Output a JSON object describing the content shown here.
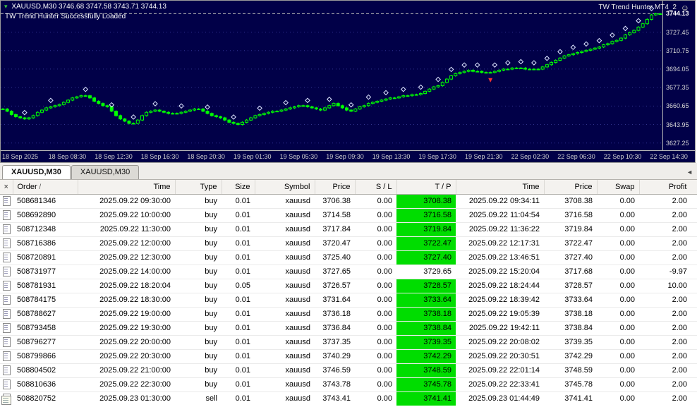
{
  "chart": {
    "symbol": "XAUUSD,M30",
    "ohlc": "3746.68 3747.58 3743.71 3744.13",
    "status_line": "TW Trend Hunter Successfully Loaded",
    "ea_label": "TW Trend Hunter MT4_2",
    "current_price": "3744.13",
    "price_labels": [
      "3727.45",
      "3710.75",
      "3694.05",
      "3677.35",
      "3660.65",
      "3643.95",
      "3627.25"
    ],
    "time_labels": [
      "18 Sep 2025",
      "18 Sep 08:30",
      "18 Sep 12:30",
      "18 Sep 16:30",
      "18 Sep 20:30",
      "19 Sep 01:30",
      "19 Sep 05:30",
      "19 Sep 09:30",
      "19 Sep 13:30",
      "19 Sep 17:30",
      "19 Sep 21:30",
      "22 Sep 02:30",
      "22 Sep 06:30",
      "22 Sep 10:30",
      "22 Sep 14:30"
    ]
  },
  "chart_data": {
    "type": "candlestick",
    "symbol": "XAUUSD",
    "timeframe": "M30",
    "ylim": [
      3622,
      3752
    ],
    "closes": [
      3658,
      3656,
      3653,
      3651,
      3650,
      3649,
      3650,
      3652,
      3655,
      3657,
      3659,
      3660,
      3661,
      3662,
      3664,
      3666,
      3668,
      3669,
      3670,
      3670,
      3668,
      3665,
      3663,
      3661,
      3660,
      3656,
      3652,
      3649,
      3647,
      3645,
      3645,
      3648,
      3652,
      3655,
      3656,
      3657,
      3656,
      3655,
      3654,
      3654,
      3654,
      3655,
      3656,
      3657,
      3658,
      3658,
      3656,
      3654,
      3652,
      3651,
      3650,
      3648,
      3646,
      3645,
      3644,
      3646,
      3648,
      3650,
      3652,
      3653,
      3654,
      3655,
      3656,
      3656,
      3657,
      3658,
      3659,
      3660,
      3661,
      3661,
      3660,
      3659,
      3658,
      3657,
      3659,
      3661,
      3663,
      3661,
      3659,
      3657,
      3656,
      3658,
      3660,
      3661,
      3663,
      3664,
      3665,
      3666,
      3667,
      3668,
      3668,
      3669,
      3670,
      3670,
      3671,
      3671,
      3672,
      3674,
      3676,
      3678,
      3679,
      3682,
      3685,
      3688,
      3690,
      3691,
      3692,
      3693,
      3692,
      3692,
      3691,
      3691,
      3691,
      3692,
      3693,
      3694,
      3694,
      3695,
      3695,
      3695,
      3694,
      3694,
      3694,
      3694,
      3696,
      3698,
      3700,
      3702,
      3704,
      3706,
      3707,
      3708,
      3709,
      3710,
      3711,
      3712,
      3713,
      3714,
      3716,
      3717,
      3719,
      3720,
      3722,
      3725,
      3727,
      3729,
      3732,
      3735,
      3739,
      3743,
      3744,
      3744
    ],
    "marker_indices": [
      5,
      11,
      19,
      25,
      30,
      35,
      41,
      47,
      53,
      59,
      65,
      70,
      75,
      80,
      84,
      88,
      92,
      96,
      100,
      103,
      106,
      109,
      113,
      116,
      119,
      122,
      125,
      128,
      131,
      134,
      137,
      140,
      143,
      146,
      149
    ],
    "sell_marker_index": 112
  },
  "colors": {
    "chart_background": "#010048",
    "bull_candle": "#00ff00",
    "grid": "#31318f",
    "tp_highlight": "#00dd00",
    "marker": "#dde4ff",
    "sell_marker": "#ff3030"
  },
  "tabs": {
    "items": [
      {
        "label": "XAUUSD,M30"
      },
      {
        "label": "XAUUSD,M30"
      }
    ],
    "active": 0,
    "scroll_left": "◄"
  },
  "history": {
    "sort_indicator": "/",
    "columns": [
      "Order",
      "Time",
      "Type",
      "Size",
      "Symbol",
      "Price",
      "S / L",
      "T / P",
      "Time",
      "Price",
      "Swap",
      "Profit"
    ],
    "rows": [
      {
        "order": "508681346",
        "open_time": "2025.09.22 09:30:00",
        "type": "buy",
        "size": "0.01",
        "symbol": "xauusd",
        "price": "3706.38",
        "sl": "0.00",
        "tp": "3708.38",
        "tp_hit": true,
        "close_time": "2025.09.22 09:34:11",
        "close_price": "3708.38",
        "swap": "0.00",
        "profit": "2.00"
      },
      {
        "order": "508692890",
        "open_time": "2025.09.22 10:00:00",
        "type": "buy",
        "size": "0.01",
        "symbol": "xauusd",
        "price": "3714.58",
        "sl": "0.00",
        "tp": "3716.58",
        "tp_hit": true,
        "close_time": "2025.09.22 11:04:54",
        "close_price": "3716.58",
        "swap": "0.00",
        "profit": "2.00"
      },
      {
        "order": "508712348",
        "open_time": "2025.09.22 11:30:00",
        "type": "buy",
        "size": "0.01",
        "symbol": "xauusd",
        "price": "3717.84",
        "sl": "0.00",
        "tp": "3719.84",
        "tp_hit": true,
        "close_time": "2025.09.22 11:36:22",
        "close_price": "3719.84",
        "swap": "0.00",
        "profit": "2.00"
      },
      {
        "order": "508716386",
        "open_time": "2025.09.22 12:00:00",
        "type": "buy",
        "size": "0.01",
        "symbol": "xauusd",
        "price": "3720.47",
        "sl": "0.00",
        "tp": "3722.47",
        "tp_hit": true,
        "close_time": "2025.09.22 12:17:31",
        "close_price": "3722.47",
        "swap": "0.00",
        "profit": "2.00"
      },
      {
        "order": "508720891",
        "open_time": "2025.09.22 12:30:00",
        "type": "buy",
        "size": "0.01",
        "symbol": "xauusd",
        "price": "3725.40",
        "sl": "0.00",
        "tp": "3727.40",
        "tp_hit": true,
        "close_time": "2025.09.22 13:46:51",
        "close_price": "3727.40",
        "swap": "0.00",
        "profit": "2.00"
      },
      {
        "order": "508731977",
        "open_time": "2025.09.22 14:00:00",
        "type": "buy",
        "size": "0.01",
        "symbol": "xauusd",
        "price": "3727.65",
        "sl": "0.00",
        "tp": "3729.65",
        "tp_hit": false,
        "close_time": "2025.09.22 15:20:04",
        "close_price": "3717.68",
        "swap": "0.00",
        "profit": "-9.97"
      },
      {
        "order": "508781931",
        "open_time": "2025.09.22 18:20:04",
        "type": "buy",
        "size": "0.05",
        "symbol": "xauusd",
        "price": "3726.57",
        "sl": "0.00",
        "tp": "3728.57",
        "tp_hit": true,
        "close_time": "2025.09.22 18:24:44",
        "close_price": "3728.57",
        "swap": "0.00",
        "profit": "10.00"
      },
      {
        "order": "508784175",
        "open_time": "2025.09.22 18:30:00",
        "type": "buy",
        "size": "0.01",
        "symbol": "xauusd",
        "price": "3731.64",
        "sl": "0.00",
        "tp": "3733.64",
        "tp_hit": true,
        "close_time": "2025.09.22 18:39:42",
        "close_price": "3733.64",
        "swap": "0.00",
        "profit": "2.00"
      },
      {
        "order": "508788627",
        "open_time": "2025.09.22 19:00:00",
        "type": "buy",
        "size": "0.01",
        "symbol": "xauusd",
        "price": "3736.18",
        "sl": "0.00",
        "tp": "3738.18",
        "tp_hit": true,
        "close_time": "2025.09.22 19:05:39",
        "close_price": "3738.18",
        "swap": "0.00",
        "profit": "2.00"
      },
      {
        "order": "508793458",
        "open_time": "2025.09.22 19:30:00",
        "type": "buy",
        "size": "0.01",
        "symbol": "xauusd",
        "price": "3736.84",
        "sl": "0.00",
        "tp": "3738.84",
        "tp_hit": true,
        "close_time": "2025.09.22 19:42:11",
        "close_price": "3738.84",
        "swap": "0.00",
        "profit": "2.00"
      },
      {
        "order": "508796277",
        "open_time": "2025.09.22 20:00:00",
        "type": "buy",
        "size": "0.01",
        "symbol": "xauusd",
        "price": "3737.35",
        "sl": "0.00",
        "tp": "3739.35",
        "tp_hit": true,
        "close_time": "2025.09.22 20:08:02",
        "close_price": "3739.35",
        "swap": "0.00",
        "profit": "2.00"
      },
      {
        "order": "508799866",
        "open_time": "2025.09.22 20:30:00",
        "type": "buy",
        "size": "0.01",
        "symbol": "xauusd",
        "price": "3740.29",
        "sl": "0.00",
        "tp": "3742.29",
        "tp_hit": true,
        "close_time": "2025.09.22 20:30:51",
        "close_price": "3742.29",
        "swap": "0.00",
        "profit": "2.00"
      },
      {
        "order": "508804502",
        "open_time": "2025.09.22 21:00:00",
        "type": "buy",
        "size": "0.01",
        "symbol": "xauusd",
        "price": "3746.59",
        "sl": "0.00",
        "tp": "3748.59",
        "tp_hit": true,
        "close_time": "2025.09.22 22:01:14",
        "close_price": "3748.59",
        "swap": "0.00",
        "profit": "2.00"
      },
      {
        "order": "508810636",
        "open_time": "2025.09.22 22:30:00",
        "type": "buy",
        "size": "0.01",
        "symbol": "xauusd",
        "price": "3743.78",
        "sl": "0.00",
        "tp": "3745.78",
        "tp_hit": true,
        "close_time": "2025.09.22 22:33:41",
        "close_price": "3745.78",
        "swap": "0.00",
        "profit": "2.00"
      },
      {
        "order": "508820752",
        "open_time": "2025.09.23 01:30:00",
        "type": "sell",
        "size": "0.01",
        "symbol": "xauusd",
        "price": "3743.41",
        "sl": "0.00",
        "tp": "3741.41",
        "tp_hit": true,
        "close_time": "2025.09.23 01:44:49",
        "close_price": "3741.41",
        "swap": "0.00",
        "profit": "2.00"
      }
    ]
  }
}
